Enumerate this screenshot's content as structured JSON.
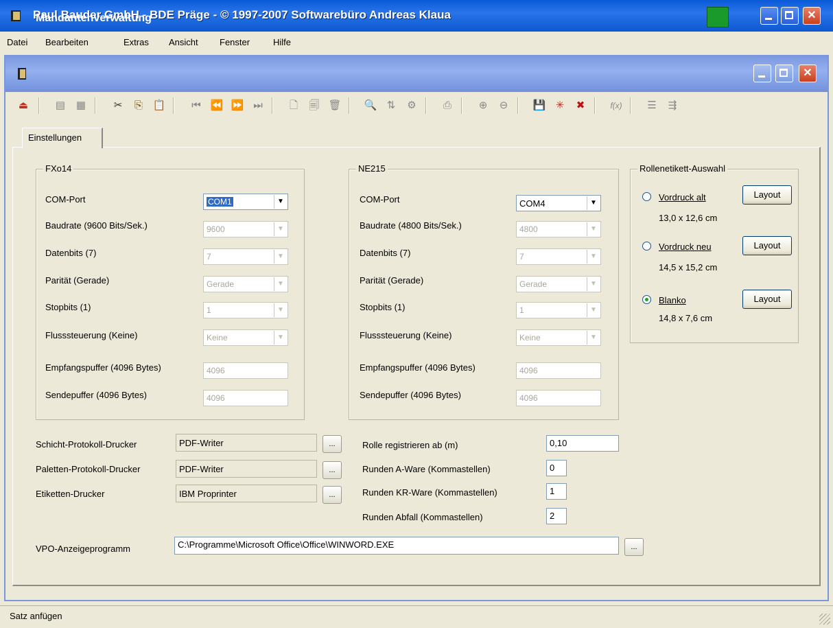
{
  "app": {
    "title": "Paul Bauder GmbH - BDE Präge - © 1997-2007 Softwarebüro Andreas Klaua"
  },
  "menu": [
    "Datei",
    "Bearbeiten",
    "Extras",
    "Ansicht",
    "Fenster",
    "Hilfe"
  ],
  "window": {
    "title": "Mandantenverwaltung"
  },
  "tabs": [
    "Einstellungen"
  ],
  "fxo14": {
    "title": "FXo14",
    "com_port_label": "COM-Port",
    "com_port": "COM1",
    "baud_label": "Baudrate (9600 Bits/Sek.)",
    "baud": "9600",
    "databits_label": "Datenbits (7)",
    "databits": "7",
    "parity_label": "Parität (Gerade)",
    "parity": "Gerade",
    "stopbits_label": "Stopbits (1)",
    "stopbits": "1",
    "flow_label": "Flusssteuerung (Keine)",
    "flow": "Keine",
    "rxbuf_label": "Empfangspuffer (4096 Bytes)",
    "rxbuf": "4096",
    "txbuf_label": "Sendepuffer (4096 Bytes)",
    "txbuf": "4096"
  },
  "ne215": {
    "title": "NE215",
    "com_port_label": "COM-Port",
    "com_port": "COM4",
    "baud_label": "Baudrate (4800 Bits/Sek.)",
    "baud": "4800",
    "databits_label": "Datenbits (7)",
    "databits": "7",
    "parity_label": "Parität (Gerade)",
    "parity": "Gerade",
    "stopbits_label": "Stopbits (1)",
    "stopbits": "1",
    "flow_label": "Flusssteuerung (Keine)",
    "flow": "Keine",
    "rxbuf_label": "Empfangspuffer (4096 Bytes)",
    "rxbuf": "4096",
    "txbuf_label": "Sendepuffer (4096 Bytes)",
    "txbuf": "4096"
  },
  "label_select": {
    "title": "Rollenetikett-Auswahl",
    "options": [
      {
        "label": "Vordruck alt",
        "size": "13,0 x 12,6 cm",
        "selected": false
      },
      {
        "label": "Vordruck neu",
        "size": "14,5 x 15,2 cm",
        "selected": false
      },
      {
        "label": "Blanko",
        "size": "14,8 x 7,6 cm",
        "selected": true
      }
    ],
    "layout_button": "Layout"
  },
  "printers": {
    "shift_label": "Schicht-Protokoll-Drucker",
    "shift": "PDF-Writer",
    "pallet_label": "Paletten-Protokoll-Drucker",
    "pallet": "PDF-Writer",
    "label_label": "Etiketten-Drucker",
    "label": "IBM Proprinter",
    "browse": "..."
  },
  "rounding": {
    "register_label": "Rolle registrieren ab (m)",
    "register": "0,10",
    "a_label": "Runden A-Ware (Kommastellen)",
    "a": "0",
    "kr_label": "Runden KR-Ware (Kommastellen)",
    "kr": "1",
    "waste_label": "Runden Abfall (Kommastellen)",
    "waste": "2"
  },
  "vpo": {
    "label": "VPO-Anzeigeprogramm",
    "path": "C:\\Programme\\Microsoft Office\\Office\\WINWORD.EXE"
  },
  "status": "Satz anfügen"
}
